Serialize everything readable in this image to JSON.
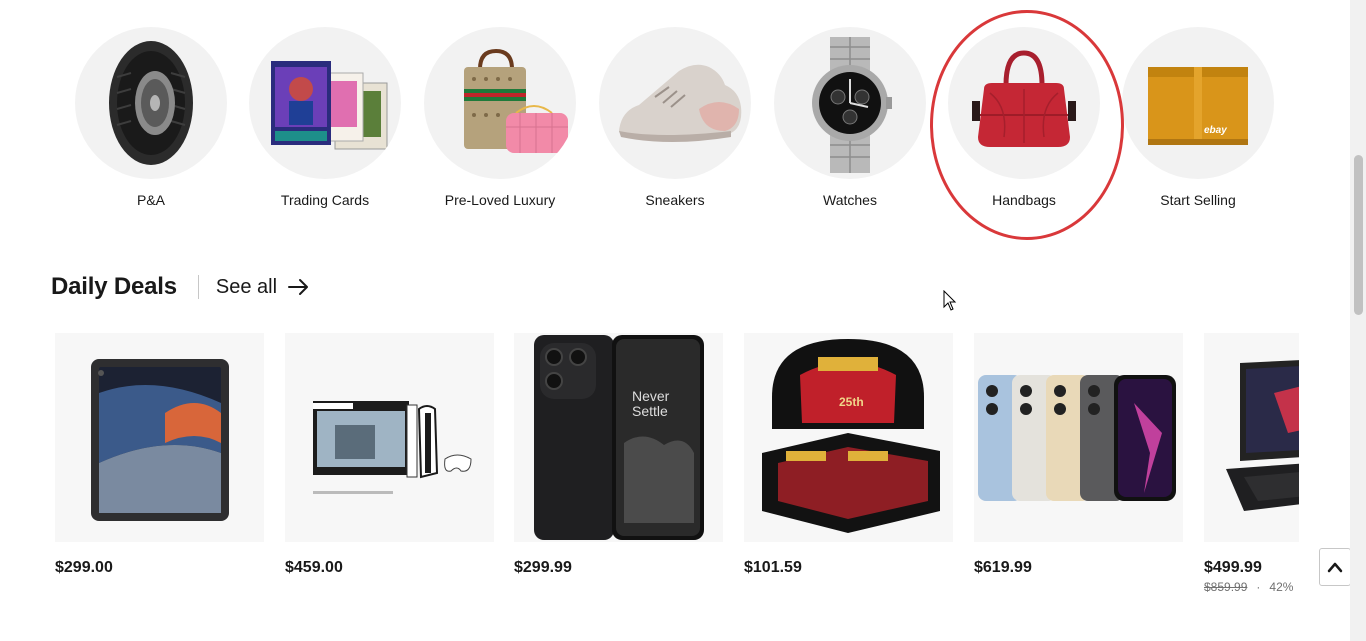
{
  "categories": [
    {
      "label": "P&A",
      "icon": "tire-icon"
    },
    {
      "label": "Trading Cards",
      "icon": "trading-cards-icon"
    },
    {
      "label": "Pre-Loved Luxury",
      "icon": "luxury-bags-icon"
    },
    {
      "label": "Sneakers",
      "icon": "sneaker-icon"
    },
    {
      "label": "Watches",
      "icon": "watch-icon"
    },
    {
      "label": "Handbags",
      "icon": "handbag-icon"
    },
    {
      "label": "Start Selling",
      "icon": "ebay-box-icon"
    }
  ],
  "deals": {
    "title": "Daily Deals",
    "see_all": "See all",
    "products": [
      {
        "price": "$299.00",
        "image": "ipad-icon"
      },
      {
        "price": "$459.00",
        "image": "ps5-bundle-icon"
      },
      {
        "price": "$299.99",
        "image": "oneplus-phone-icon",
        "image_text": "Never Settle"
      },
      {
        "price": "$101.59",
        "image": "card-booster-box-icon",
        "image_text": "25th"
      },
      {
        "price": "$619.99",
        "image": "iphone-pro-icon"
      },
      {
        "price": "$499.99",
        "image": "gaming-laptop-icon",
        "original_price": "$859.99",
        "separator": "·",
        "discount": "42%"
      }
    ]
  },
  "brand_box_text": "ebay",
  "colors": {
    "highlight": "#d9383a",
    "circle_bg": "#f2f2f2",
    "card_bg": "#f7f7f7",
    "text": "#191919"
  }
}
